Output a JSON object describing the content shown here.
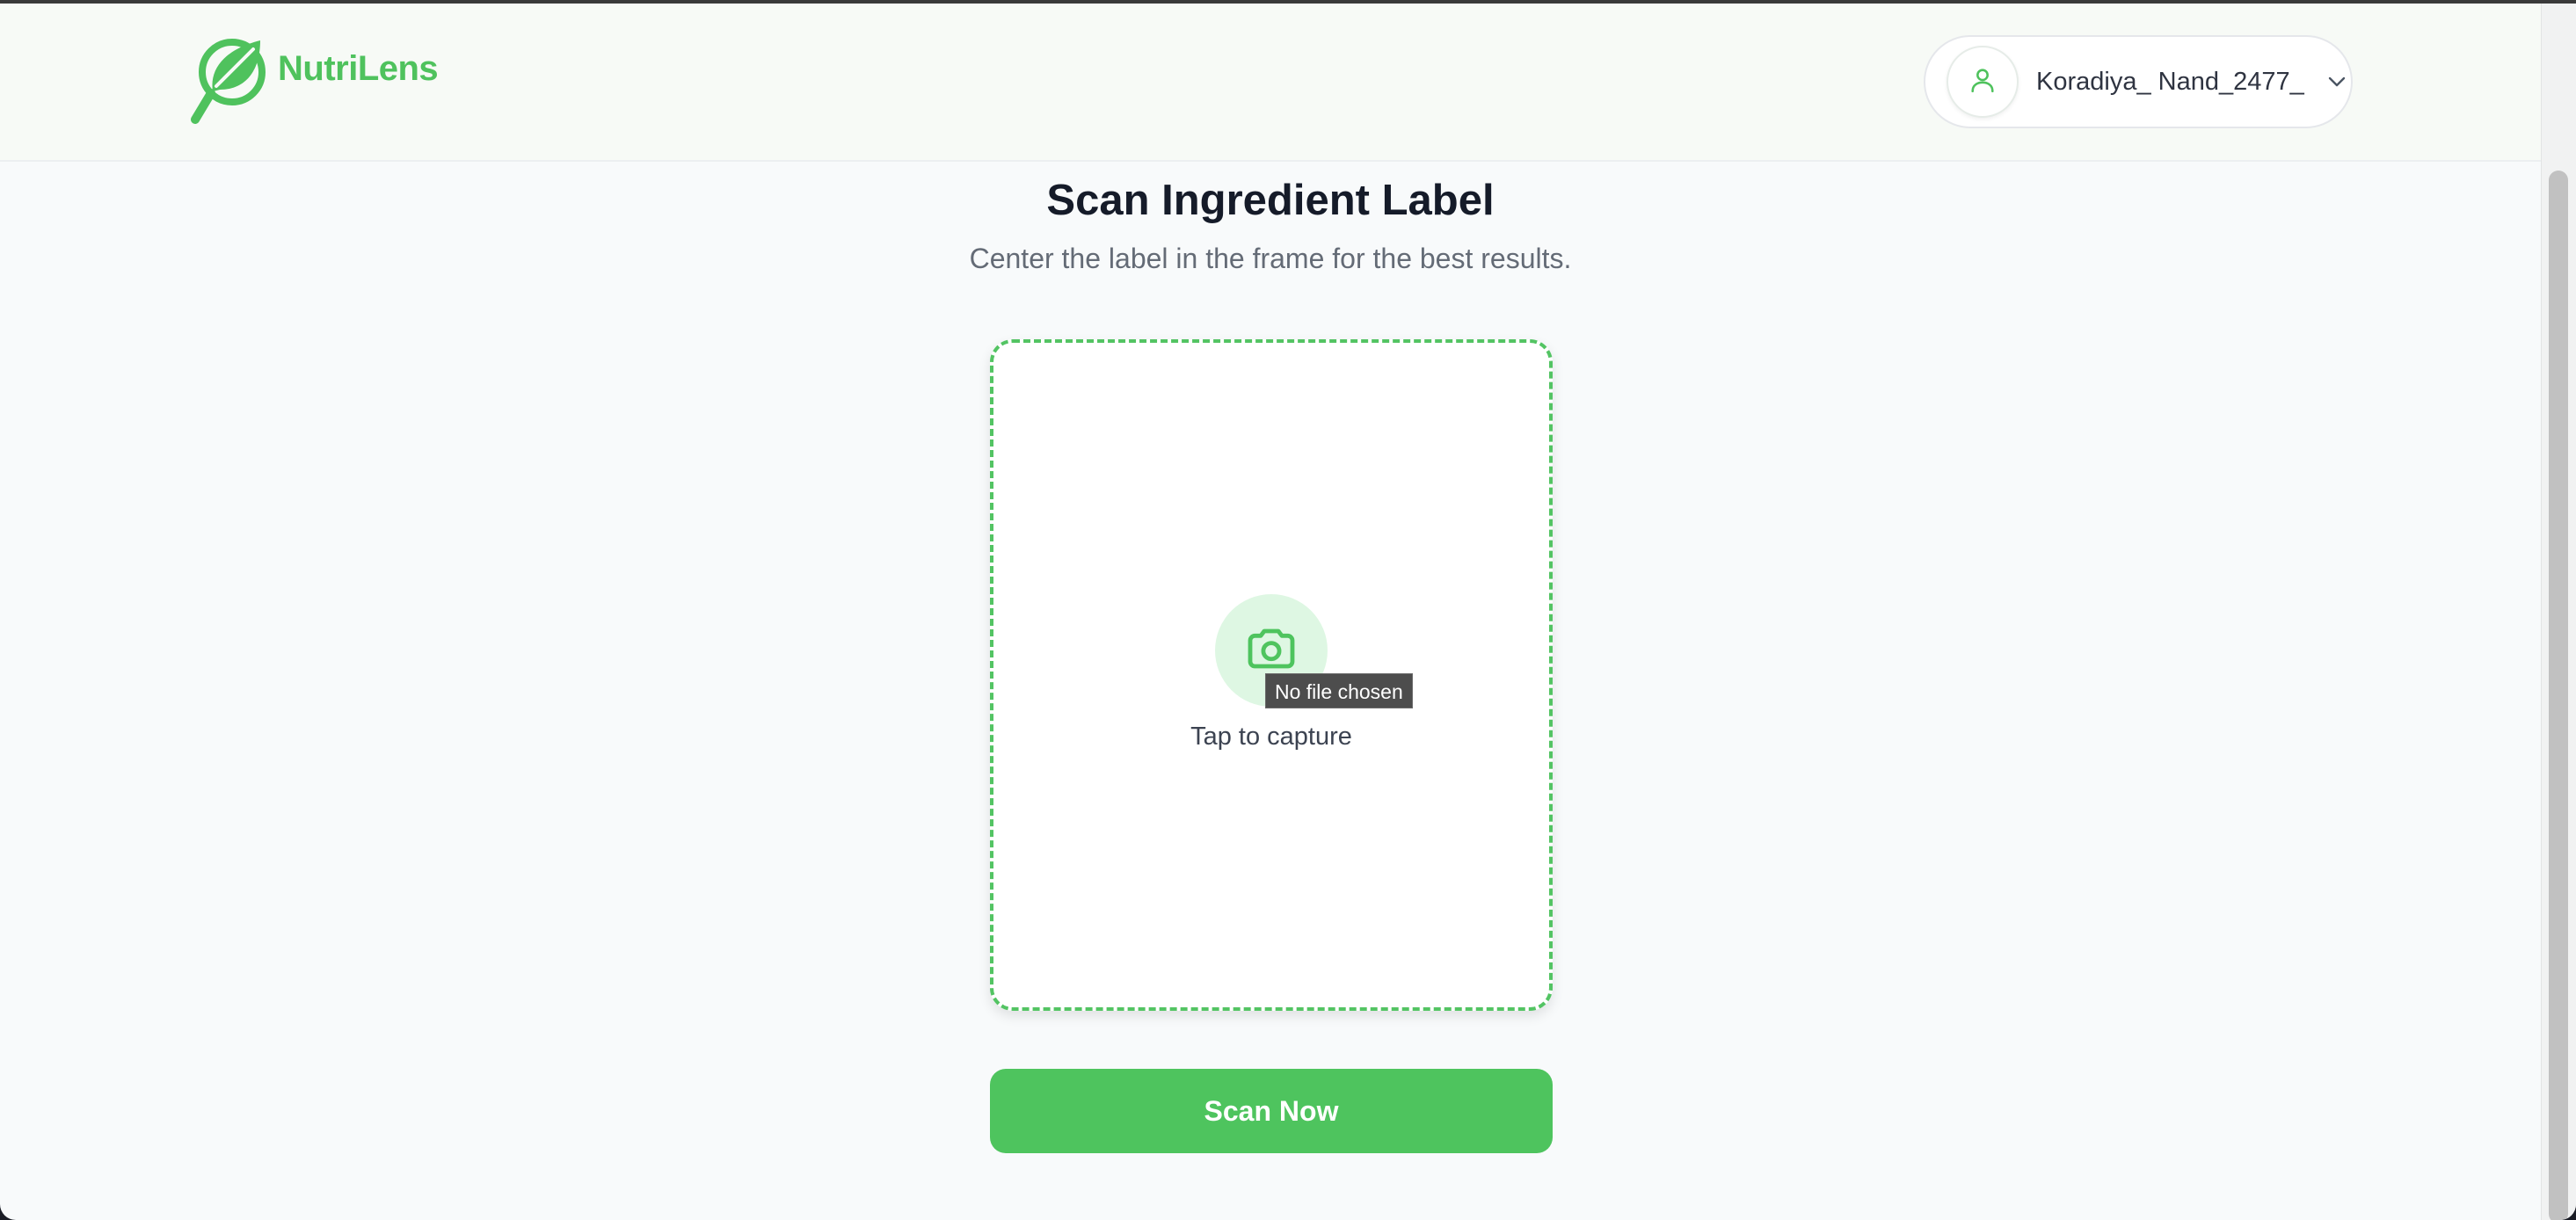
{
  "brand": {
    "name": "NutriLens",
    "logo_icon": "leaf-magnifier-icon",
    "color": "#4fc25d"
  },
  "user_menu": {
    "username": "Koradiya_ Nand_2477_",
    "avatar_icon": "user-icon",
    "chevron_icon": "chevron-down-icon"
  },
  "main": {
    "title": "Scan Ingredient Label",
    "subtitle": "Center the label in the frame for the best results.",
    "capture": {
      "icon": "camera-icon",
      "label": "Tap to capture",
      "tooltip": "No file chosen"
    },
    "scan_button_label": "Scan Now"
  },
  "colors": {
    "accent": "#4ec45e",
    "accent_light": "#def7e3",
    "title": "#151b29",
    "subtitle": "#646b76"
  }
}
